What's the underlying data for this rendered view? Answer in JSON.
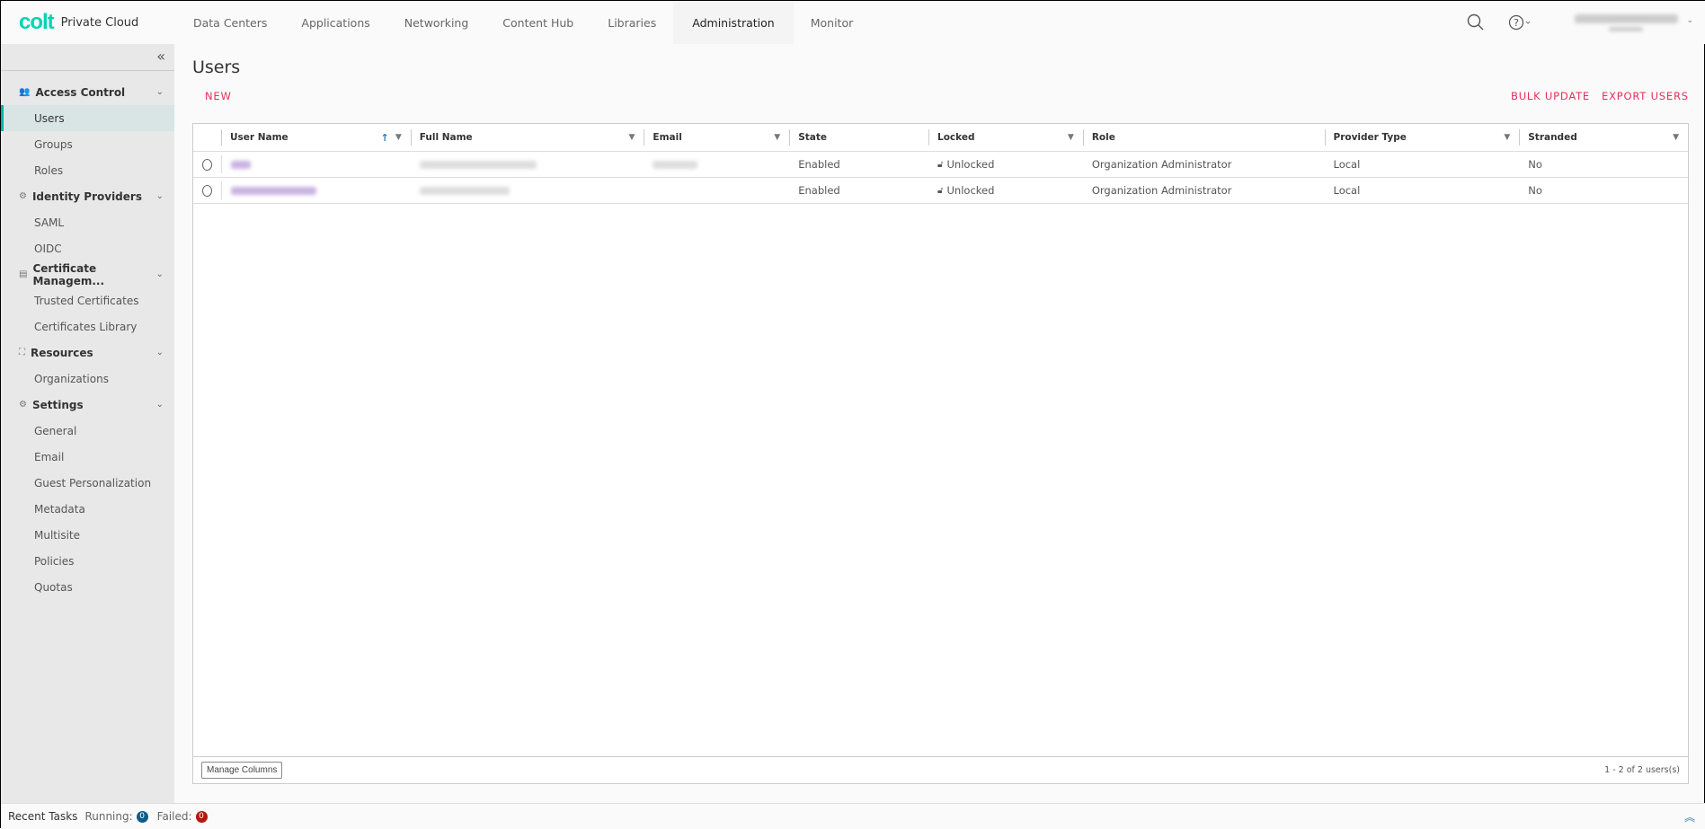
{
  "header": {
    "brand": "colt",
    "product": "Private Cloud",
    "nav": [
      "Data Centers",
      "Applications",
      "Networking",
      "Content Hub",
      "Libraries",
      "Administration",
      "Monitor"
    ],
    "active_nav": "Administration"
  },
  "sidebar": {
    "collapse": "«",
    "groups": [
      {
        "label": "Access Control",
        "icon": "users-icon",
        "items": [
          "Users",
          "Groups",
          "Roles"
        ]
      },
      {
        "label": "Identity Providers",
        "icon": "identity-icon",
        "items": [
          "SAML",
          "OIDC"
        ]
      },
      {
        "label": "Certificate Managem...",
        "icon": "certificate-icon",
        "items": [
          "Trusted Certificates",
          "Certificates Library"
        ]
      },
      {
        "label": "Resources",
        "icon": "resources-icon",
        "items": [
          "Organizations"
        ]
      },
      {
        "label": "Settings",
        "icon": "gear-icon",
        "items": [
          "General",
          "Email",
          "Guest Personalization",
          "Metadata",
          "Multisite",
          "Policies",
          "Quotas"
        ]
      }
    ],
    "active_item": "Users"
  },
  "page": {
    "title": "Users",
    "new": "NEW",
    "bulk_update": "BULK UPDATE",
    "export_users": "EXPORT USERS"
  },
  "grid": {
    "columns": [
      "User Name",
      "Full Name",
      "Email",
      "State",
      "Locked",
      "Role",
      "Provider Type",
      "Stranded"
    ],
    "rows": [
      {
        "state": "Enabled",
        "locked": "Unlocked",
        "role": "Organization Administrator",
        "provider": "Local",
        "stranded": "No"
      },
      {
        "state": "Enabled",
        "locked": "Unlocked",
        "role": "Organization Administrator",
        "provider": "Local",
        "stranded": "No"
      }
    ],
    "manage_columns": "Manage Columns",
    "count": "1 - 2 of 2 users(s)"
  },
  "footer": {
    "recent_tasks": "Recent Tasks",
    "running_label": "Running:",
    "running": "0",
    "failed_label": "Failed:",
    "failed": "0"
  },
  "colors": {
    "brand": "#00d4b4",
    "accent": "#e5315a",
    "running": "#0f5c8a",
    "failed": "#b0190b"
  }
}
